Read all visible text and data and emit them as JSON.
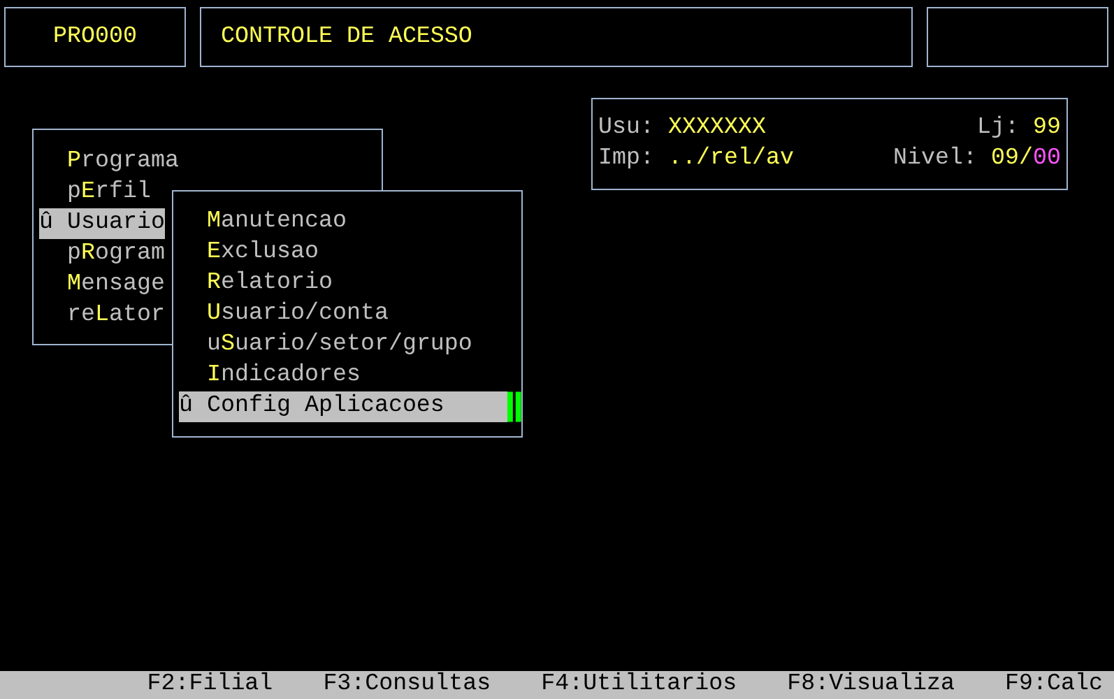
{
  "header": {
    "program_code": "PRO000",
    "title": "CONTROLE DE ACESSO"
  },
  "info": {
    "rows": [
      {
        "left": {
          "label": "Usu:",
          "parts": [
            {
              "text": "XXXXXXX",
              "color": "#ffff55"
            }
          ]
        },
        "right": {
          "label": "Lj:",
          "parts": [
            {
              "text": "99",
              "color": "#ffff55"
            }
          ]
        }
      },
      {
        "left": {
          "label": "Imp:",
          "parts": [
            {
              "text": "../rel/av",
              "color": "#ffff55"
            }
          ]
        },
        "right": {
          "label": "Nivel:",
          "parts": [
            {
              "text": "09/",
              "color": "#ffff55"
            },
            {
              "text": "00",
              "color": "#ff55ff"
            }
          ]
        }
      }
    ]
  },
  "main_menu": {
    "items": [
      {
        "hotkey": "P",
        "rest": "rograma",
        "selected": false
      },
      {
        "prefix": "p",
        "hotkey": "E",
        "rest": "rfil",
        "selected": false
      },
      {
        "marker": "û",
        "hotkey": "U",
        "rest": "suario",
        "selected": true
      },
      {
        "prefix": "p",
        "hotkey": "R",
        "rest": "ogram",
        "selected": false
      },
      {
        "hotkey": "M",
        "rest": "ensage",
        "selected": false
      },
      {
        "prefix": "re",
        "hotkey": "L",
        "rest": "ator",
        "selected": false
      }
    ]
  },
  "submenu": {
    "items": [
      {
        "hotkey": "M",
        "rest": "anutencao",
        "selected": false
      },
      {
        "hotkey": "E",
        "rest": "xclusao",
        "selected": false
      },
      {
        "hotkey": "R",
        "rest": "elatorio",
        "selected": false
      },
      {
        "hotkey": "U",
        "rest": "suario/conta",
        "selected": false
      },
      {
        "prefix": "u",
        "hotkey": "S",
        "rest": "uario/setor/grupo",
        "selected": false
      },
      {
        "hotkey": "I",
        "rest": "ndicadores",
        "selected": false
      },
      {
        "marker": "û",
        "hotkey": "C",
        "rest": "onfig Aplicacoes",
        "selected": true
      }
    ]
  },
  "function_keys": [
    "F2:Filial",
    "F3:Consultas",
    "F4:Utilitarios",
    "F8:Visualiza",
    "F9:Calc"
  ]
}
